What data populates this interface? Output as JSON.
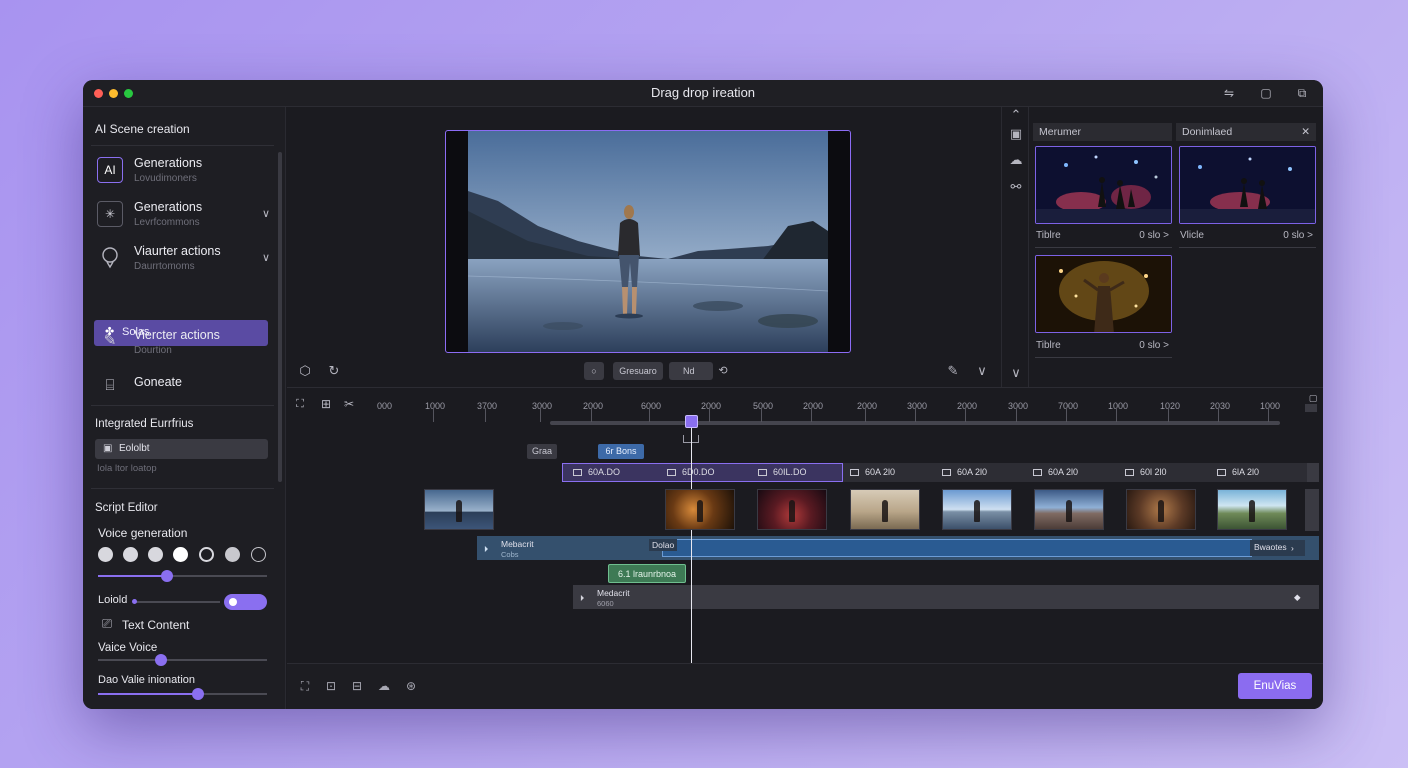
{
  "window": {
    "title": "Drag drop ireation"
  },
  "sidebar": {
    "title": "AI Scene creation",
    "items": [
      {
        "label": "Generations",
        "sub": "Lovudimoners",
        "icon": "ai-badge-icon"
      },
      {
        "label": "Generations",
        "sub": "Levrfcommons",
        "icon": "sparkle-icon"
      },
      {
        "label": "Viaurter actions",
        "sub": "Daurrtomoms",
        "icon": "microphone-icon"
      },
      {
        "label": "Solas",
        "icon": "puzzle-icon"
      },
      {
        "label": "Viercter actions",
        "sub": "Dourtion",
        "icon": "edit-icon"
      },
      {
        "label": "Goneate",
        "icon": "generate-icon"
      }
    ],
    "integrated_title": "Integrated Eurrfrius",
    "integrated_field": "Eololbt",
    "integrated_note": "Iola ltor loatop",
    "script_editor": "Script Editor",
    "voice_generation": "Voice generation",
    "loiold_label": "Loiold",
    "text_content": "Text Content",
    "voice_voice": "Vaice Voice",
    "dao_valie": "Dao Valie inionation",
    "voice_slider_level": 0.41,
    "loiold_slider_level": 0.6,
    "voice_voice_level": 0.37,
    "dao_valie_level": 0.59
  },
  "preview": {
    "controls": {
      "middle_label": "Gresuaro",
      "right_label": "Nd"
    }
  },
  "right_panel": {
    "header_left": "Merumer",
    "header_right": "Donimlaed",
    "thumbs": [
      {
        "caption": "Tiblre",
        "meta": "0 slo >"
      },
      {
        "caption": "Vlicle",
        "meta": "0 slo >"
      },
      {
        "caption": "Tiblre",
        "meta": "0 slo >"
      }
    ]
  },
  "timeline": {
    "ruler": [
      "000",
      "1000",
      "3700",
      "3000",
      "2000",
      "6000",
      "2000",
      "5000",
      "2000",
      "2000",
      "3000",
      "2000",
      "3000",
      "7000",
      "1000",
      "1020",
      "2030",
      "1000"
    ],
    "tags": {
      "grey": "Graa",
      "blue": "6r Bons",
      "green": "6.1 lraunrbnoa"
    },
    "segments": [
      "60A.DO",
      "6D0.DO",
      "60IL.DO",
      "60A 2l0",
      "60A 2l0",
      "60A 2l0",
      "60l 2l0",
      "6lA 2l0"
    ],
    "audio1": {
      "title": "Mebacrit",
      "sub": "Cobs",
      "mid": "Dolao",
      "right": "Bwaotes"
    },
    "audio2": {
      "title": "Medacrit",
      "sub": "6060"
    }
  },
  "bottom": {
    "export_label": "EnuVias"
  },
  "colors": {
    "accent": "#8b6cf0",
    "background": "#1b1b20"
  }
}
